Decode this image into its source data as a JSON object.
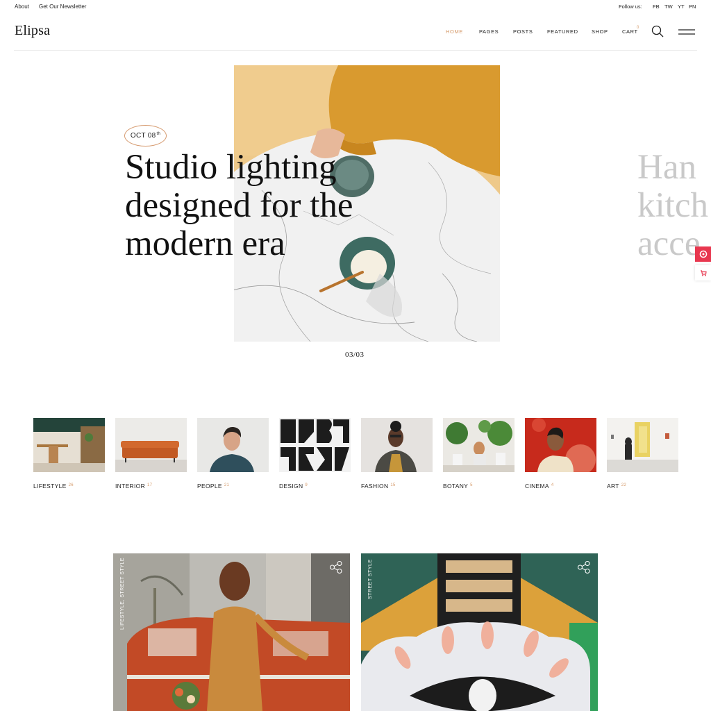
{
  "topbar": {
    "about": "About",
    "newsletter": "Get Our Newsletter",
    "follow_label": "Follow us:",
    "social": [
      "FB",
      "TW",
      "YT",
      "PN"
    ]
  },
  "header": {
    "logo": "Elipsa",
    "nav": [
      "HOME",
      "PAGES",
      "POSTS",
      "FEATURED",
      "SHOP",
      "CART"
    ],
    "active_nav": "HOME",
    "cart_count": "0"
  },
  "hero": {
    "date_day": "OCT 08",
    "date_suffix": "th",
    "title_lines": [
      "Studio lighting",
      "designed for the",
      "modern era"
    ],
    "next_title_lines": [
      "Han",
      "kitch",
      "acce"
    ],
    "pager": "03/03"
  },
  "categories": [
    {
      "label": "LIFESTYLE",
      "count": "26"
    },
    {
      "label": "INTERIOR",
      "count": "17"
    },
    {
      "label": "PEOPLE",
      "count": "21"
    },
    {
      "label": "DESIGN",
      "count": "9"
    },
    {
      "label": "FASHION",
      "count": "15"
    },
    {
      "label": "BOTANY",
      "count": "5"
    },
    {
      "label": "CINEMA",
      "count": "4"
    },
    {
      "label": "ART",
      "count": "22"
    }
  ],
  "posts": [
    {
      "tags": "LIFESTYLE, STREET STYLE"
    },
    {
      "tags": "STREET STYLE"
    }
  ],
  "colors": {
    "accent": "#d59a6a",
    "side_widget": "#e8374f"
  },
  "icons": [
    "search-icon",
    "menu-icon",
    "share-icon",
    "cart-icon",
    "circle-icon"
  ]
}
